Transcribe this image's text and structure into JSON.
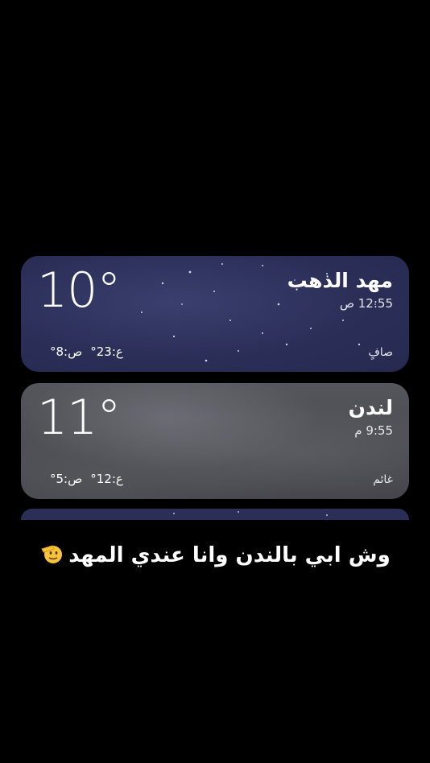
{
  "cards": [
    {
      "city": "مهد الذهب",
      "time": "12:55 ص",
      "temperature": "10°",
      "condition": "صافٍ",
      "high": "ع:23°",
      "low": "ص:8°"
    },
    {
      "city": "لندن",
      "time": "9:55 م",
      "temperature": "11°",
      "condition": "غائم",
      "high": "ع:12°",
      "low": "ص:5°"
    }
  ],
  "caption": "وش ابي بالندن وانا عندي المهد",
  "caption_emoji": "saluting-face-icon",
  "colors": {
    "night_card": "#2b2f58",
    "cloudy_card": "#4a4a50",
    "background": "#000000"
  }
}
